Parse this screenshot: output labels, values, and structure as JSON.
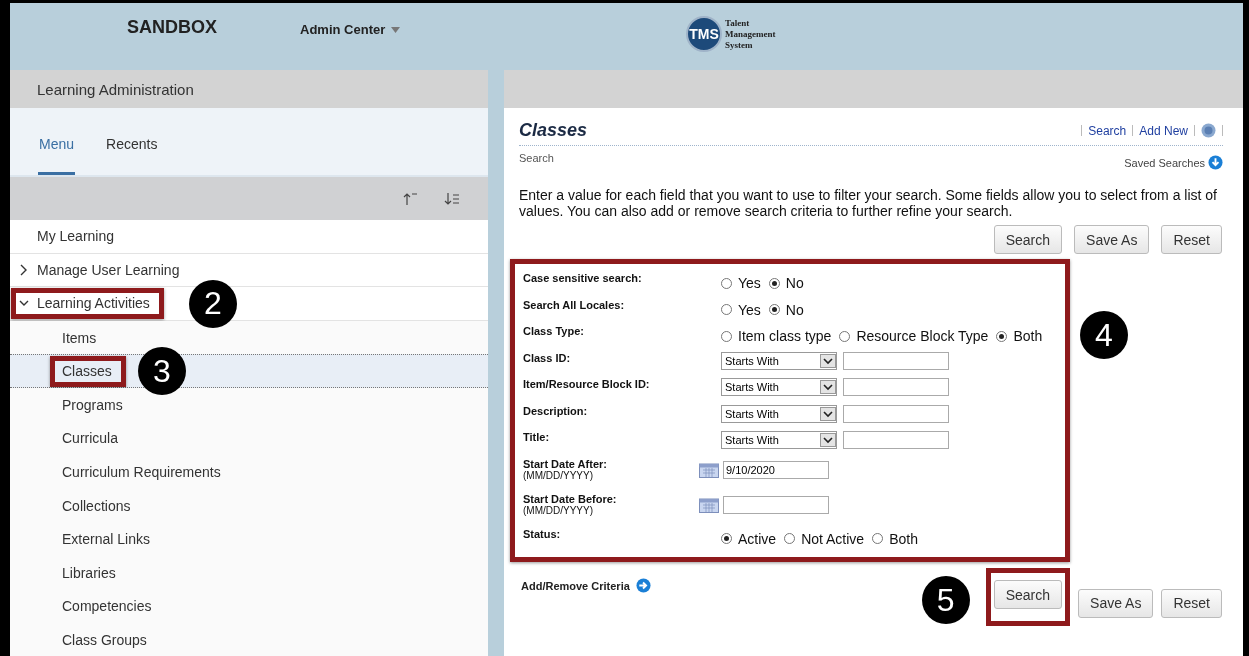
{
  "header": {
    "brand": "SANDBOX",
    "nav": "Admin Center",
    "logo_badge": "TMS",
    "logo_text": [
      "Talent",
      "Management",
      "System"
    ]
  },
  "sidebar": {
    "title": "Learning Administration",
    "tabs": [
      {
        "label": "Menu",
        "selected": true
      },
      {
        "label": "Recents",
        "selected": false
      }
    ],
    "items": [
      {
        "label": "My Learning",
        "selected": false
      },
      {
        "label": "Manage User Learning",
        "expanded": false,
        "selected": false
      },
      {
        "label": "Learning Activities",
        "expanded": true,
        "selected": false,
        "callout": "2",
        "children": [
          {
            "label": "Items",
            "selected": false
          },
          {
            "label": "Classes",
            "selected": true,
            "callout": "3"
          },
          {
            "label": "Programs",
            "selected": false
          },
          {
            "label": "Curricula",
            "selected": false
          },
          {
            "label": "Curriculum Requirements",
            "selected": false
          },
          {
            "label": "Collections",
            "selected": false
          },
          {
            "label": "External Links",
            "selected": false
          },
          {
            "label": "Libraries",
            "selected": false
          },
          {
            "label": "Competencies",
            "selected": false
          },
          {
            "label": "Class Groups",
            "selected": false
          }
        ]
      }
    ]
  },
  "main": {
    "title": "Classes",
    "links": [
      "Search",
      "Add New"
    ],
    "subtitle": "Search",
    "saved_searches": "Saved Searches",
    "intro": "Enter a value for each field that you want to use to filter your search. Some fields allow you to select from a list of values. You can also add or remove search criteria to further refine your search.",
    "top_buttons": [
      "Search",
      "Save As",
      "Reset"
    ],
    "form_callout": "4",
    "fields": [
      {
        "kind": "radio",
        "label": "Case sensitive search:",
        "options": [
          {
            "label": "Yes",
            "selected": false
          },
          {
            "label": "No",
            "selected": true
          }
        ]
      },
      {
        "kind": "radio",
        "label": "Search All Locales:",
        "options": [
          {
            "label": "Yes",
            "selected": false
          },
          {
            "label": "No",
            "selected": true
          }
        ]
      },
      {
        "kind": "radio",
        "label": "Class Type:",
        "options": [
          {
            "label": "Item class type",
            "selected": false
          },
          {
            "label": "Resource Block Type",
            "selected": false
          },
          {
            "label": "Both",
            "selected": true
          }
        ]
      },
      {
        "kind": "select",
        "label": "Class ID:",
        "operator": "Starts With"
      },
      {
        "kind": "select",
        "label": "Item/Resource Block ID:",
        "operator": "Starts With"
      },
      {
        "kind": "select",
        "label": "Description:",
        "operator": "Starts With"
      },
      {
        "kind": "select",
        "label": "Title:",
        "operator": "Starts With"
      },
      {
        "kind": "date",
        "label": "Start Date After:",
        "hint": "(MM/DD/YYYY)",
        "value": "9/10/2020"
      },
      {
        "kind": "date",
        "label": "Start Date Before:",
        "hint": "(MM/DD/YYYY)"
      },
      {
        "kind": "radio",
        "label": "Status:",
        "options": [
          {
            "label": "Active",
            "selected": true
          },
          {
            "label": "Not Active",
            "selected": false
          },
          {
            "label": "Both",
            "selected": false
          }
        ]
      }
    ],
    "add_remove": "Add/Remove Criteria",
    "bottom_buttons": [
      {
        "label": "Search",
        "callout": "5"
      },
      {
        "label": "Save As"
      },
      {
        "label": "Reset"
      }
    ]
  }
}
